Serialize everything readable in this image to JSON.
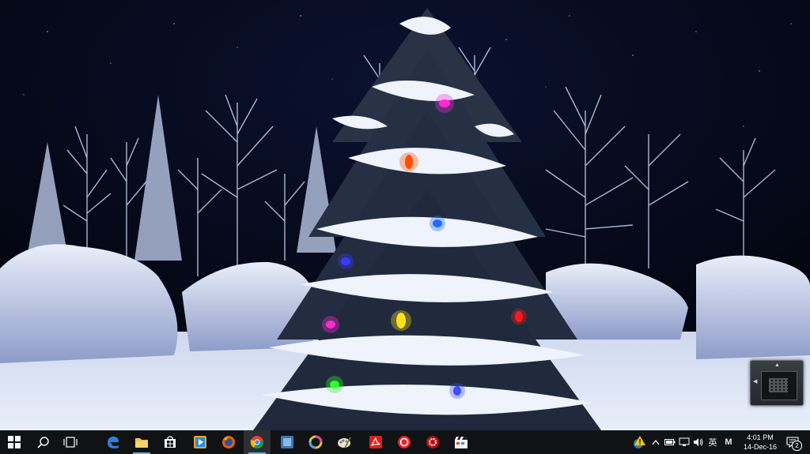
{
  "wallpaper": {
    "scene": "snow-covered-christmas-tree-night",
    "sky_color": "#05070f",
    "snow_color": "#dfe7f5",
    "light_colors": [
      "#ff2ad4",
      "#ff4d00",
      "#1e6bff",
      "#3a3aff",
      "#ff2ad4",
      "#ffe11a",
      "#ff1a1a",
      "#2bff2b",
      "#3b4dff"
    ]
  },
  "widget": {
    "icon": "keyboard-grid-icon"
  },
  "taskbar": {
    "start": {
      "icon": "windows-start-icon"
    },
    "pinned": [
      {
        "name": "search",
        "icon": "search-icon"
      },
      {
        "name": "task-view",
        "icon": "task-view-icon"
      },
      {
        "name": "edge",
        "icon": "edge-browser-icon"
      },
      {
        "name": "file-explorer",
        "icon": "folder-icon"
      },
      {
        "name": "store",
        "icon": "store-bag-icon"
      },
      {
        "name": "media-player",
        "icon": "media-player-icon"
      },
      {
        "name": "firefox",
        "icon": "firefox-icon"
      },
      {
        "name": "chrome",
        "icon": "chrome-icon"
      },
      {
        "name": "app-blue-square",
        "icon": "blue-square-app-icon"
      },
      {
        "name": "app-ring",
        "icon": "ring-app-icon"
      },
      {
        "name": "paint",
        "icon": "paint-palette-icon"
      },
      {
        "name": "acrobat",
        "icon": "acrobat-pdf-icon"
      },
      {
        "name": "app-red-badge-1",
        "icon": "red-round-app-icon"
      },
      {
        "name": "app-red-badge-2",
        "icon": "red-gear-app-icon"
      },
      {
        "name": "video-editor",
        "icon": "clapperboard-icon"
      }
    ],
    "tray": {
      "chevron_icon": "chevron-up-icon",
      "warning_icon": "warning-icon",
      "battery_icon": "battery-icon",
      "network_icon": "network-icon",
      "volume_icon": "volume-icon",
      "ime_label": "英",
      "ime_mode_label": "M",
      "time": "4:01 PM",
      "date": "14-Dec-16",
      "notification_count": "2",
      "notification_icon": "action-center-icon"
    },
    "accent_color": "#6fa8dc"
  }
}
